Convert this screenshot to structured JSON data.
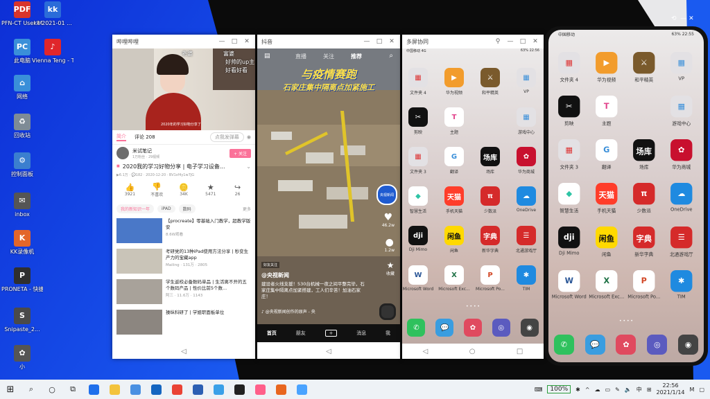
{
  "desktop": {
    "icons": [
      {
        "label": "PFN-CT User Manual (...",
        "glyph": "PDF",
        "color": "#d9342b"
      },
      {
        "label": "kk 2021-01 ...",
        "glyph": "kk",
        "color": "#2b6cd9"
      },
      {
        "label": "此电脑",
        "glyph": "PC",
        "color": "#3a8fd9"
      },
      {
        "label": "Vienna Teng - The Tower",
        "glyph": "♪",
        "color": "#e0262b"
      },
      {
        "label": "网络",
        "glyph": "⌂",
        "color": "#3a8fd9"
      },
      {
        "label": "回收站",
        "glyph": "♻",
        "color": "#7e8b96"
      },
      {
        "label": "控制面板",
        "glyph": "⚙",
        "color": "#3b7fcf"
      },
      {
        "label": "inbox",
        "glyph": "✉",
        "color": "#555"
      },
      {
        "label": "KK录像机",
        "glyph": "K",
        "color": "#e3662a"
      },
      {
        "label": "PRONETA - 快捷方式",
        "glyph": "P",
        "color": "#2f2f2f"
      },
      {
        "label": "Snipaste_2...",
        "glyph": "S",
        "color": "#4a4a4a"
      },
      {
        "label": "小",
        "glyph": "✿",
        "color": "#555"
      }
    ]
  },
  "window1": {
    "title": "哔哩哔哩",
    "video_caption_left": "老婆",
    "video_caption_right": "富婆",
    "danmaku1": "好帅的up主",
    "danmaku2": "好看好看",
    "subtitle": "2020年的学习好物分享了",
    "tab_intro": "简介",
    "tab_comments": "评论 208",
    "danmaku_btn": "点我发弹幕",
    "uploader": "米试笔记",
    "uploader_meta": "1万粉丝 · 29视频",
    "follow": "+ 关注",
    "video_title": "2020我的学习好物分享 | 电子学习设备...",
    "stats": "▶6.1万 · 💬182 · 2020-12-20 · BV1sf4y1w7JG",
    "actions": [
      {
        "icon": "👍",
        "count": "3921"
      },
      {
        "icon": "👎",
        "count": "不喜欢"
      },
      {
        "icon": "🪙",
        "count": "34K"
      },
      {
        "icon": "★",
        "count": "5471"
      },
      {
        "icon": "↪",
        "count": "26"
      }
    ],
    "tags": [
      "我的新知识一年",
      "iPAD",
      "数码"
    ],
    "more": "更多",
    "related": [
      {
        "title": "【procreate】零基础入门教学，超教学版安",
        "meta": "8.6W观看"
      },
      {
        "title": "考研党的13种iPad使用方法分享 | 秒变生产力的宝藏app",
        "meta": "Mailing · 131万 · 2805"
      },
      {
        "title": "学生返校必备数码单品 | 生活离不开的五个数码产品 | 性价比前5个数...",
        "meta": "阿三 · 11.6万 · 1143"
      },
      {
        "title": "操纵科研了 | 学姐职面板单位",
        "meta": ""
      }
    ]
  },
  "window2": {
    "title": "抖音",
    "top_tabs": [
      "直播",
      "关注",
      "推荐"
    ],
    "headline1": "与疫情赛跑",
    "headline2": "石家庄集中隔离点加紧施工",
    "account": "@央视新闻",
    "follow_tag": "好友关注",
    "caption": "建设者火线支援！530台机械一夜之间平整完毕，石家庄集中隔离点加紧搭建，工人们辛苦！加油石家庄！",
    "music": "♪ @央视新闻创作的原声 - 央",
    "likes": "46.2w",
    "comments": "1.2w",
    "shares": "收藏",
    "channel": "央视新闻",
    "bottom_tabs": [
      "首页",
      "朋友",
      "+",
      "消息",
      "我"
    ]
  },
  "window3": {
    "title": "多屏协同",
    "status_left": "中国移动 4G",
    "status_right": "63% 22:56"
  },
  "phone_status": {
    "left": "中国移动",
    "right": "63% 22:55"
  },
  "apps": [
    {
      "label": "文件夹 4",
      "color": "#e3e1e4",
      "glyph": "▦",
      "fg": "#d33"
    },
    {
      "label": "华为视频",
      "color": "#f29c2c",
      "glyph": "▶",
      "fg": "#fff"
    },
    {
      "label": "和平精英",
      "color": "#7a5a2c",
      "glyph": "⚔",
      "fg": "#fff"
    },
    {
      "label": "VP",
      "color": "#e3e1e4",
      "glyph": "▦",
      "fg": "#3a8fd9"
    },
    {
      "label": "剪映",
      "color": "#111",
      "glyph": "✂",
      "fg": "#fff"
    },
    {
      "label": "主题",
      "color": "#ffffff",
      "glyph": "T",
      "fg": "#e2448c"
    },
    {
      "label": "",
      "color": "transparent",
      "glyph": "",
      "fg": "#fff"
    },
    {
      "label": "游戏中心",
      "color": "#e3e1e4",
      "glyph": "▦",
      "fg": "#3a8fd9"
    },
    {
      "label": "文件夹 3",
      "color": "#e3e1e4",
      "glyph": "▦",
      "fg": "#d33"
    },
    {
      "label": "翻译",
      "color": "#ffffff",
      "glyph": "G",
      "fg": "#3a8fd9"
    },
    {
      "label": "场库",
      "color": "#111",
      "glyph": "场库",
      "fg": "#fff"
    },
    {
      "label": "华为商城",
      "color": "#c8102e",
      "glyph": "✿",
      "fg": "#fff"
    },
    {
      "label": "智慧生活",
      "color": "#ffffff",
      "glyph": "◆",
      "fg": "#2ec4a5"
    },
    {
      "label": "手机天猫",
      "color": "#ff3d2a",
      "glyph": "天猫",
      "fg": "#fff"
    },
    {
      "label": "少数派",
      "color": "#d52a2a",
      "glyph": "π",
      "fg": "#fff"
    },
    {
      "label": "OneDrive",
      "color": "#1f8ae0",
      "glyph": "☁",
      "fg": "#fff"
    },
    {
      "label": "Dji Mimo",
      "color": "#111",
      "glyph": "dji",
      "fg": "#fff"
    },
    {
      "label": "闲鱼",
      "color": "#ffd900",
      "glyph": "闲鱼",
      "fg": "#111"
    },
    {
      "label": "新华字典",
      "color": "#d52a2a",
      "glyph": "字典",
      "fg": "#fff"
    },
    {
      "label": "北通游戏厅",
      "color": "#d52a2a",
      "glyph": "☰",
      "fg": "#fff"
    },
    {
      "label": "Microsoft Word",
      "color": "#ffffff",
      "glyph": "W",
      "fg": "#2b5797"
    },
    {
      "label": "Microsoft Exc...",
      "color": "#ffffff",
      "glyph": "X",
      "fg": "#1e7145"
    },
    {
      "label": "Microsoft Po...",
      "color": "#ffffff",
      "glyph": "P",
      "fg": "#d24726"
    },
    {
      "label": "TIM",
      "color": "#1f8ae0",
      "glyph": "✱",
      "fg": "#fff"
    }
  ],
  "dock_apps": [
    {
      "name": "phone",
      "color": "#2fc15d",
      "glyph": "✆"
    },
    {
      "name": "messages",
      "color": "#3a9de0",
      "glyph": "💬"
    },
    {
      "name": "huawei",
      "color": "#e04a5f",
      "glyph": "✿"
    },
    {
      "name": "browser",
      "color": "#5b5bbf",
      "glyph": "◎"
    },
    {
      "name": "camera",
      "color": "#444",
      "glyph": "◉"
    }
  ],
  "taskbar": {
    "battery": "100%",
    "time": "22:56",
    "date": "2021/1/14",
    "ime": "中",
    "apps": [
      "#1f6feb",
      "#f3c33c",
      "#4a90e2",
      "#1565c0",
      "#ea4335",
      "#2c5fb3",
      "#3aa0e8",
      "#222",
      "#ff5f8a",
      "#e8661f",
      "#4aa3ff"
    ]
  }
}
